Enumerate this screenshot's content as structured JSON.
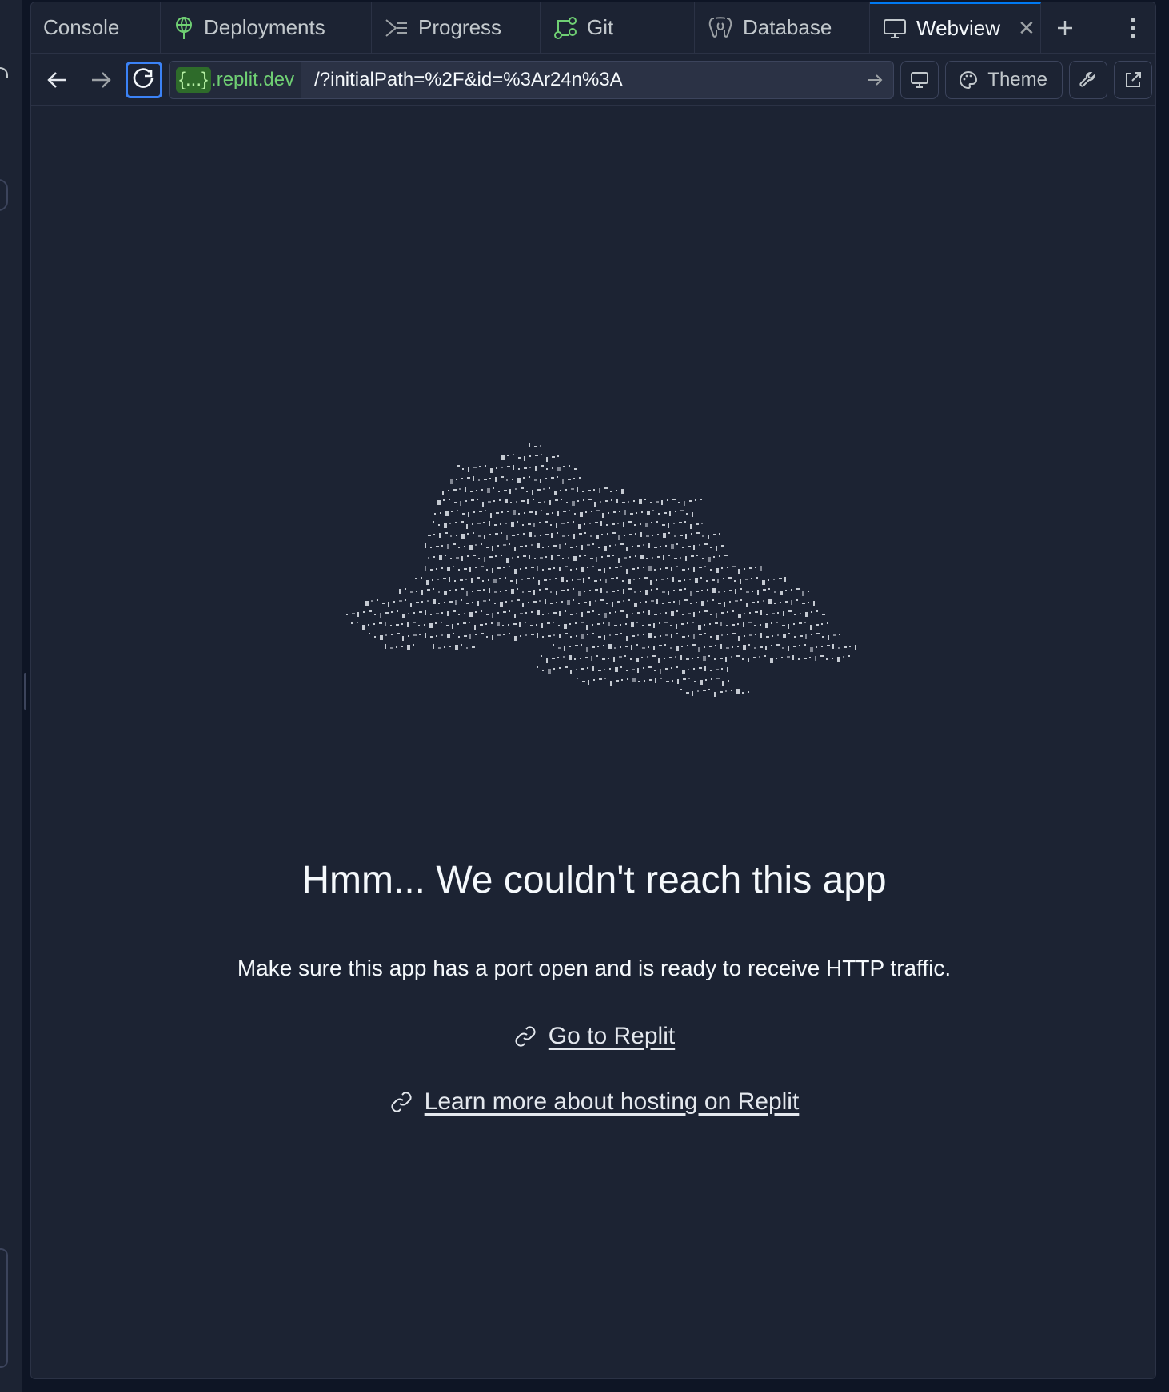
{
  "tabs": [
    {
      "label": "Console",
      "icon": "console",
      "active": false
    },
    {
      "label": "Deployments",
      "icon": "deployments-icon",
      "active": false
    },
    {
      "label": "Progress",
      "icon": "progress-icon",
      "active": false
    },
    {
      "label": "Git",
      "icon": "git-icon",
      "active": false
    },
    {
      "label": "Database",
      "icon": "database-icon",
      "active": false
    },
    {
      "label": "Webview",
      "icon": "monitor-icon",
      "active": true
    }
  ],
  "toolbar": {
    "url_badge": "{...}",
    "url_domain": ".replit.dev",
    "url_path": "/?initialPath=%2F&id=%3Ar24n%3A",
    "theme_label": "Theme"
  },
  "error": {
    "title": "Hmm... We couldn't reach this app",
    "subtitle": "Make sure this app has a port open and is ready to receive HTTP traffic.",
    "link1": "Go to Replit",
    "link2": "Learn more about hosting on Replit"
  },
  "colors": {
    "background": "#1c2333",
    "active_tab_accent": "#0079f2",
    "domain_green": "#6fcf73",
    "reload_focus": "#3b82f6"
  }
}
